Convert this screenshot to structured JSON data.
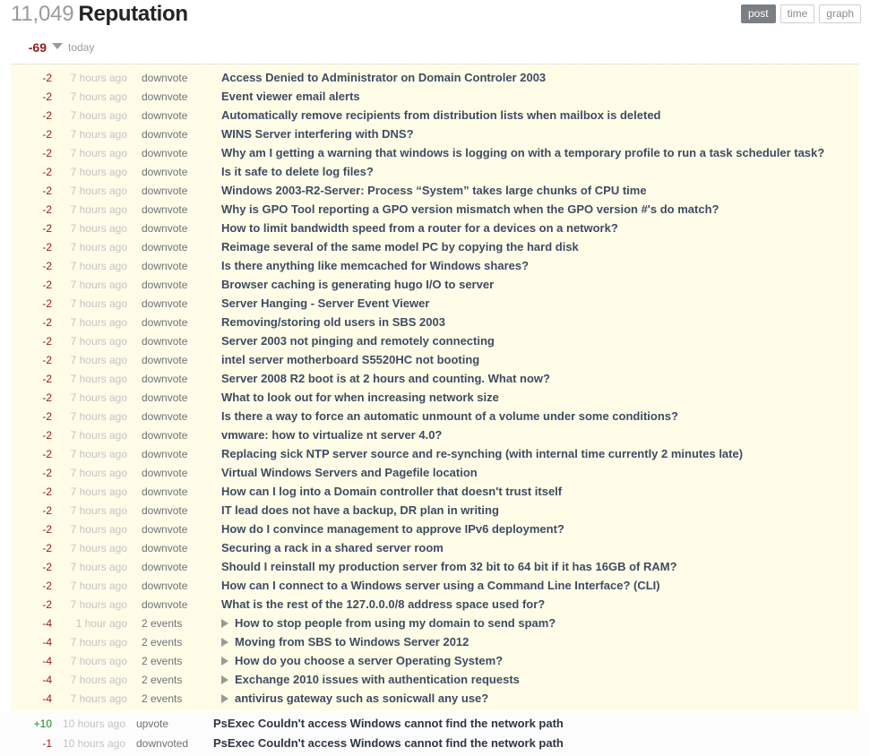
{
  "header": {
    "reputation_count": "11,049",
    "reputation_label": "Reputation",
    "view_buttons": [
      {
        "label": "post",
        "active": true
      },
      {
        "label": "time",
        "active": false
      },
      {
        "label": "graph",
        "active": false
      }
    ]
  },
  "day_group": {
    "score": "-69",
    "label": "today",
    "caret_icon": "chevron-down-icon"
  },
  "columns": [
    "score",
    "time",
    "action",
    "title"
  ],
  "rows": [
    {
      "score": "-2",
      "time": "7 hours ago",
      "action": "downvote",
      "title": "Access Denied to Administrator on Domain Controler 2003",
      "expandable": false
    },
    {
      "score": "-2",
      "time": "7 hours ago",
      "action": "downvote",
      "title": "Event viewer email alerts",
      "expandable": false
    },
    {
      "score": "-2",
      "time": "7 hours ago",
      "action": "downvote",
      "title": "Automatically remove recipients from distribution lists when mailbox is deleted",
      "expandable": false
    },
    {
      "score": "-2",
      "time": "7 hours ago",
      "action": "downvote",
      "title": "WINS Server interfering with DNS?",
      "expandable": false
    },
    {
      "score": "-2",
      "time": "7 hours ago",
      "action": "downvote",
      "title": "Why am I getting a warning that windows is logging on with a temporary profile to run a task scheduler task?",
      "expandable": false
    },
    {
      "score": "-2",
      "time": "7 hours ago",
      "action": "downvote",
      "title": "Is it safe to delete log files?",
      "expandable": false
    },
    {
      "score": "-2",
      "time": "7 hours ago",
      "action": "downvote",
      "title": "Windows 2003-R2-Server: Process “System” takes large chunks of CPU time",
      "expandable": false
    },
    {
      "score": "-2",
      "time": "7 hours ago",
      "action": "downvote",
      "title": "Why is GPO Tool reporting a GPO version mismatch when the GPO version #'s do match?",
      "expandable": false
    },
    {
      "score": "-2",
      "time": "7 hours ago",
      "action": "downvote",
      "title": "How to limit bandwidth speed from a router for a devices on a network?",
      "expandable": false
    },
    {
      "score": "-2",
      "time": "7 hours ago",
      "action": "downvote",
      "title": "Reimage several of the same model PC by copying the hard disk",
      "expandable": false
    },
    {
      "score": "-2",
      "time": "7 hours ago",
      "action": "downvote",
      "title": "Is there anything like memcached for Windows shares?",
      "expandable": false
    },
    {
      "score": "-2",
      "time": "7 hours ago",
      "action": "downvote",
      "title": "Browser caching is generating hugo I/O to server",
      "expandable": false
    },
    {
      "score": "-2",
      "time": "7 hours ago",
      "action": "downvote",
      "title": "Server Hanging - Server Event Viewer",
      "expandable": false
    },
    {
      "score": "-2",
      "time": "7 hours ago",
      "action": "downvote",
      "title": "Removing/storing old users in SBS 2003",
      "expandable": false
    },
    {
      "score": "-2",
      "time": "7 hours ago",
      "action": "downvote",
      "title": "Server 2003 not pinging and remotely connecting",
      "expandable": false
    },
    {
      "score": "-2",
      "time": "7 hours ago",
      "action": "downvote",
      "title": "intel server motherboard S5520HC not booting",
      "expandable": false
    },
    {
      "score": "-2",
      "time": "7 hours ago",
      "action": "downvote",
      "title": "Server 2008 R2 boot is at 2 hours and counting. What now?",
      "expandable": false
    },
    {
      "score": "-2",
      "time": "7 hours ago",
      "action": "downvote",
      "title": "What to look out for when increasing network size",
      "expandable": false
    },
    {
      "score": "-2",
      "time": "7 hours ago",
      "action": "downvote",
      "title": "Is there a way to force an automatic unmount of a volume under some conditions?",
      "expandable": false
    },
    {
      "score": "-2",
      "time": "7 hours ago",
      "action": "downvote",
      "title": "vmware: how to virtualize nt server 4.0?",
      "expandable": false
    },
    {
      "score": "-2",
      "time": "7 hours ago",
      "action": "downvote",
      "title": "Replacing sick NTP server source and re-synching (with internal time currently 2 minutes late)",
      "expandable": false
    },
    {
      "score": "-2",
      "time": "7 hours ago",
      "action": "downvote",
      "title": "Virtual Windows Servers and Pagefile location",
      "expandable": false
    },
    {
      "score": "-2",
      "time": "7 hours ago",
      "action": "downvote",
      "title": "How can I log into a Domain controller that doesn't trust itself",
      "expandable": false
    },
    {
      "score": "-2",
      "time": "7 hours ago",
      "action": "downvote",
      "title": "IT lead does not have a backup, DR plan in writing",
      "expandable": false
    },
    {
      "score": "-2",
      "time": "7 hours ago",
      "action": "downvote",
      "title": "How do I convince management to approve IPv6 deployment?",
      "expandable": false
    },
    {
      "score": "-2",
      "time": "7 hours ago",
      "action": "downvote",
      "title": "Securing a rack in a shared server room",
      "expandable": false
    },
    {
      "score": "-2",
      "time": "7 hours ago",
      "action": "downvote",
      "title": "Should I reinstall my production server from 32 bit to 64 bit if it has 16GB of RAM?",
      "expandable": false
    },
    {
      "score": "-2",
      "time": "7 hours ago",
      "action": "downvote",
      "title": "How can I connect to a Windows server using a Command Line Interface? (CLI)",
      "expandable": false
    },
    {
      "score": "-2",
      "time": "7 hours ago",
      "action": "downvote",
      "title": "What is the rest of the 127.0.0.0/8 address space used for?",
      "expandable": false
    },
    {
      "score": "-4",
      "time": "1 hour ago",
      "action": "2 events",
      "title": "How to stop people from using my domain to send spam?",
      "expandable": true
    },
    {
      "score": "-4",
      "time": "7 hours ago",
      "action": "2 events",
      "title": "Moving from SBS to Windows Server 2012",
      "expandable": true
    },
    {
      "score": "-4",
      "time": "7 hours ago",
      "action": "2 events",
      "title": "How do you choose a server Operating System?",
      "expandable": true
    },
    {
      "score": "-4",
      "time": "7 hours ago",
      "action": "2 events",
      "title": "Exchange 2010 issues with authentication requests",
      "expandable": true
    },
    {
      "score": "-4",
      "time": "7 hours ago",
      "action": "2 events",
      "title": "antivirus gateway such as sonicwall any use?",
      "expandable": true
    }
  ],
  "tail_rows": [
    {
      "score": "+10",
      "positive": true,
      "time": "10 hours ago",
      "action": "upvote",
      "title": "PsExec Couldn't access Windows cannot find the network path"
    },
    {
      "score": "-1",
      "positive": false,
      "time": "10 hours ago",
      "action": "downvoted",
      "title": "PsExec Couldn't access Windows cannot find the network path"
    }
  ],
  "colors": {
    "negative": "#9c1818",
    "positive": "#1a8a1a",
    "row_background": "#fffde8",
    "title_link": "#3e4c63",
    "muted": "#c3c3c3",
    "active_button_bg": "#7a7f84"
  }
}
